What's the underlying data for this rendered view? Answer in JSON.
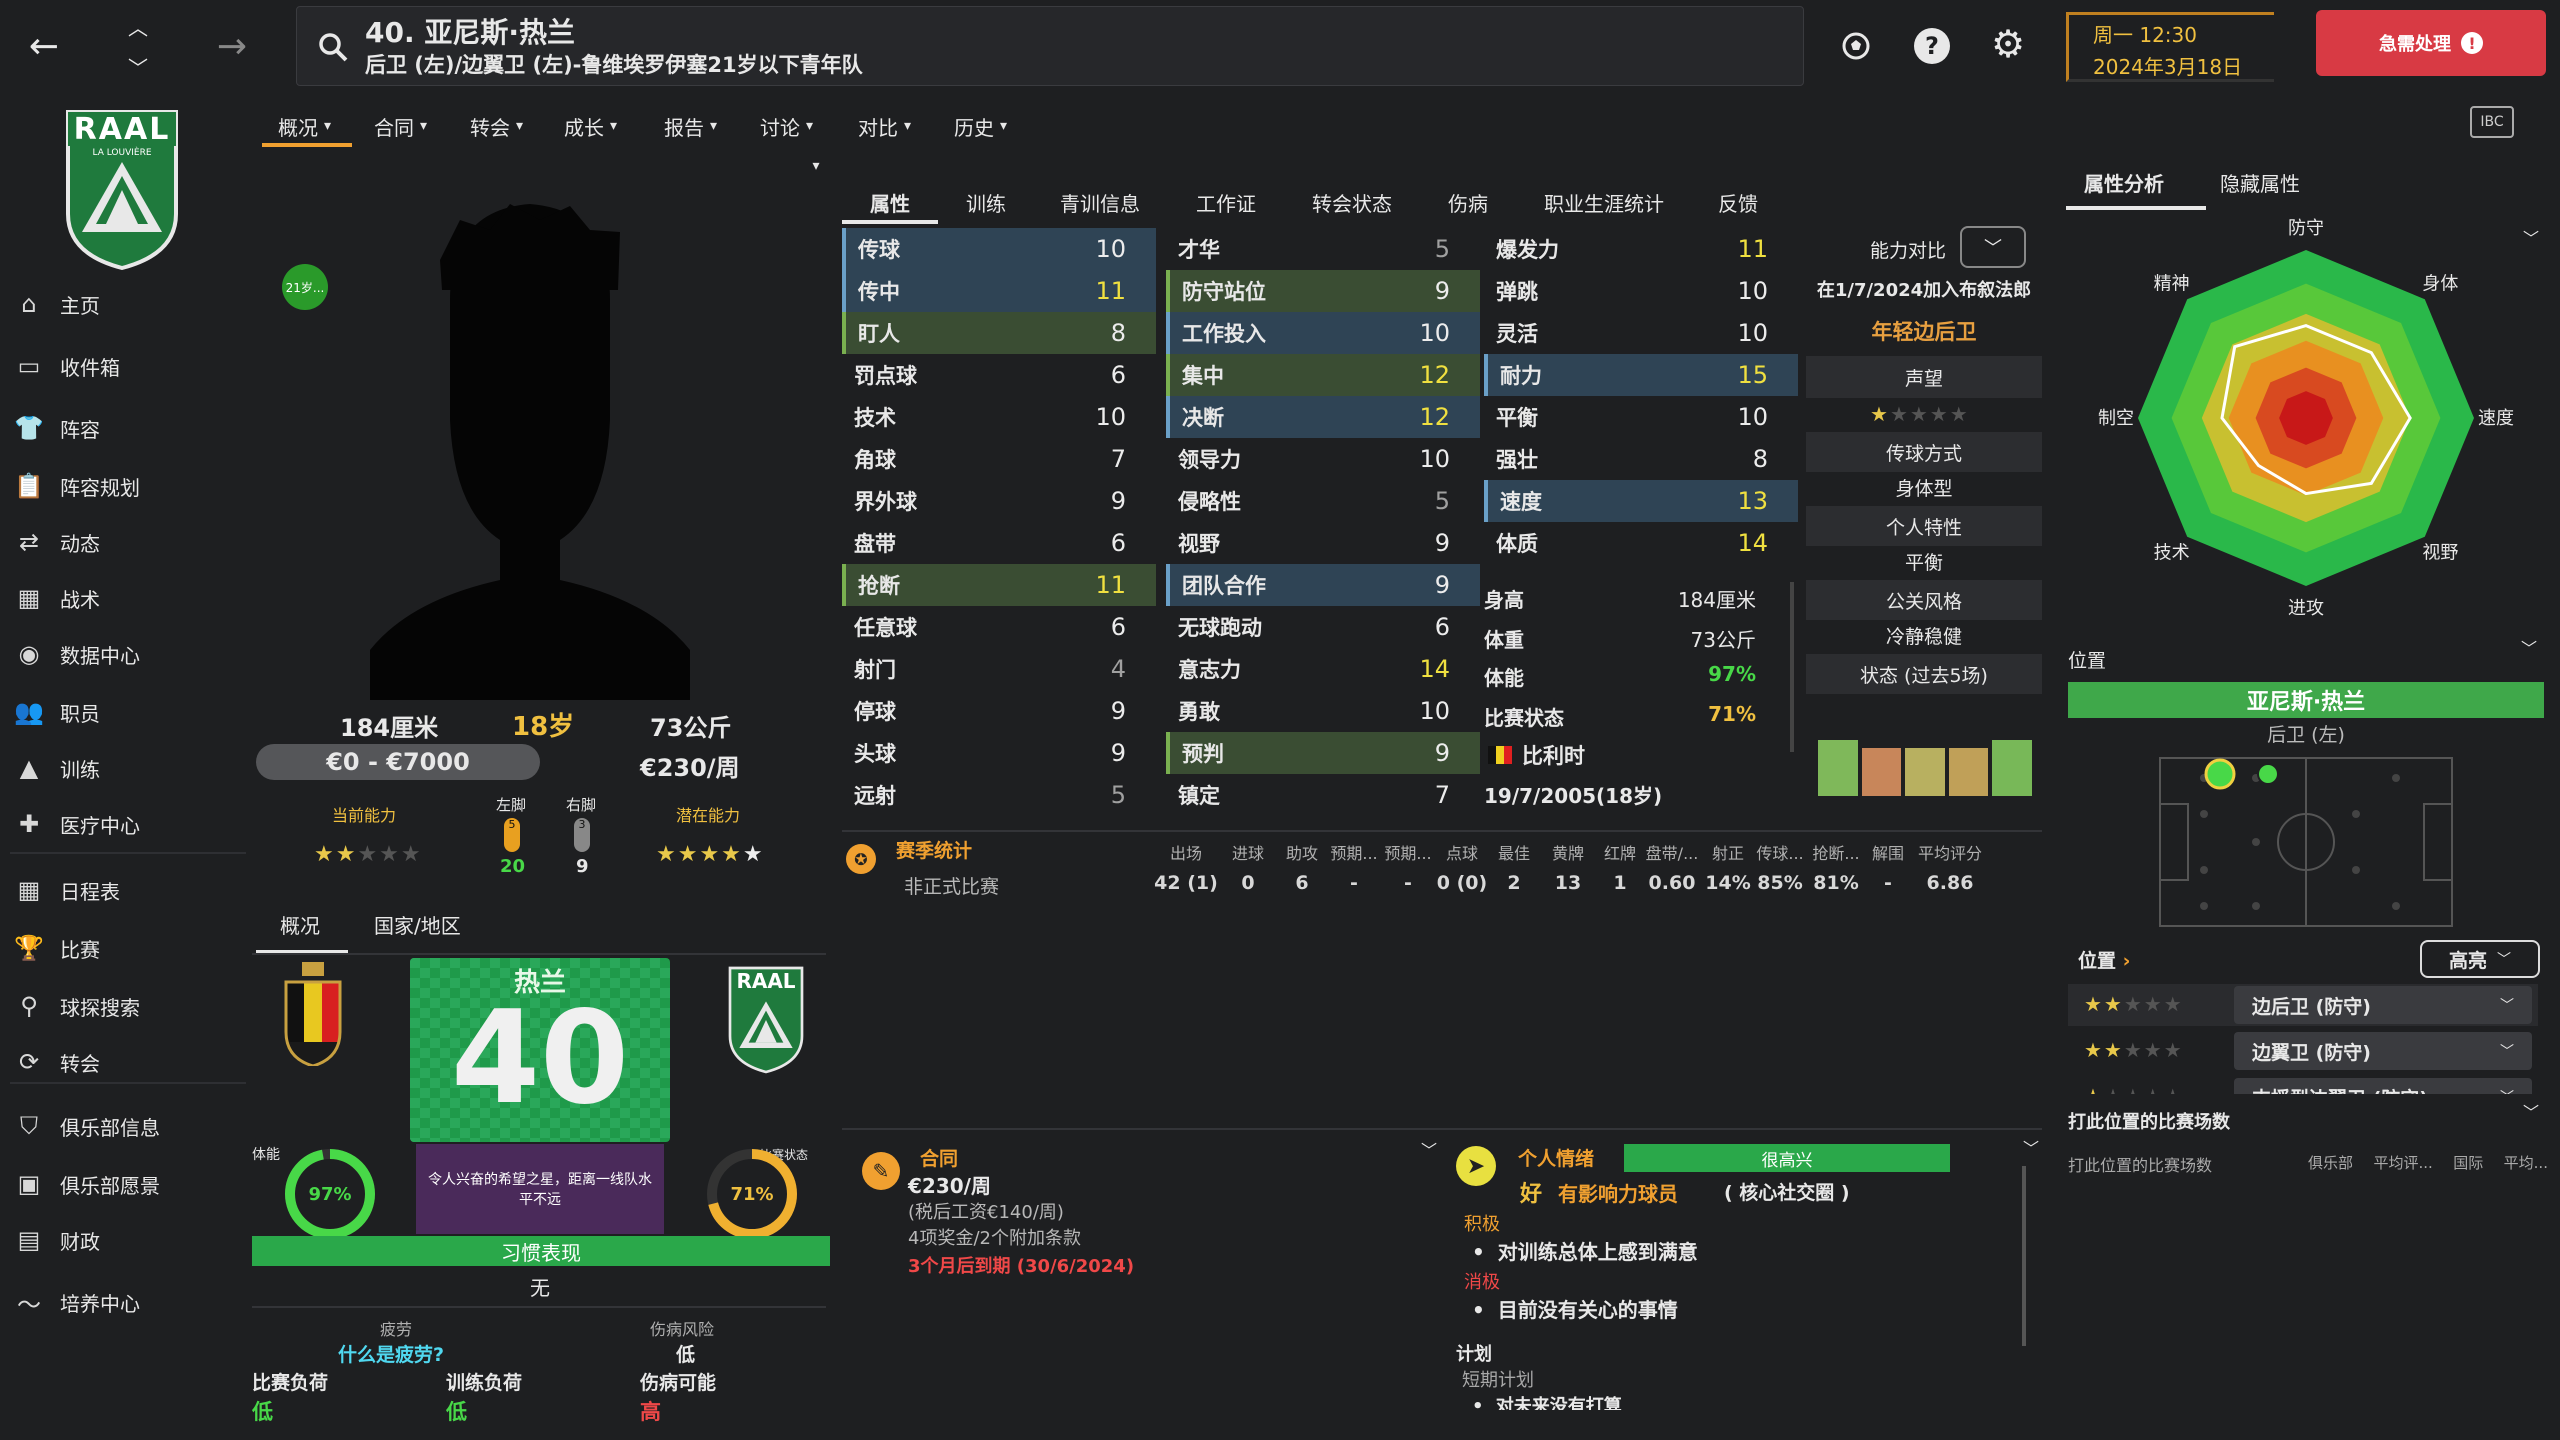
{
  "header": {
    "player_title": "40. 亚尼斯·热兰",
    "player_subtitle": "后卫 (左)/边翼卫 (左)-鲁维埃罗伊塞21岁以下青年队",
    "day_time": "周一 12:30",
    "date": "2024年3月18日",
    "urgent_label": "急需处理",
    "icons": [
      "back-arrow-icon",
      "up-chevron-icon",
      "down-chevron-icon",
      "forward-arrow-icon",
      "search-icon",
      "football-icon",
      "help-icon",
      "gear-icon",
      "alert-icon",
      "ibc-icon"
    ]
  },
  "club": {
    "badge_text": "RAAL",
    "badge_sub": "LA LOUVIÈRE"
  },
  "sidebar": {
    "items": [
      {
        "label": "主页",
        "icon": "home-icon"
      },
      {
        "label": "收件箱",
        "icon": "inbox-icon"
      },
      {
        "label": "阵容",
        "icon": "shirt-icon"
      },
      {
        "label": "阵容规划",
        "icon": "clipboard-icon"
      },
      {
        "label": "动态",
        "icon": "dynamics-icon"
      },
      {
        "label": "战术",
        "icon": "tactics-icon"
      },
      {
        "label": "数据中心",
        "icon": "data-icon"
      },
      {
        "label": "职员",
        "icon": "staff-icon"
      },
      {
        "label": "训练",
        "icon": "training-icon"
      },
      {
        "label": "医疗中心",
        "icon": "medical-icon"
      },
      {
        "label": "日程表",
        "icon": "calendar-icon"
      },
      {
        "label": "比赛",
        "icon": "trophy-icon"
      },
      {
        "label": "球探搜索",
        "icon": "scout-search-icon"
      },
      {
        "label": "转会",
        "icon": "transfer-icon"
      },
      {
        "label": "俱乐部信息",
        "icon": "shield-icon"
      },
      {
        "label": "俱乐部愿景",
        "icon": "vision-icon"
      },
      {
        "label": "财政",
        "icon": "finance-icon"
      },
      {
        "label": "培养中心",
        "icon": "development-icon"
      }
    ]
  },
  "menu": [
    "概况",
    "合同",
    "转会",
    "成长",
    "报告",
    "讨论",
    "对比",
    "历史"
  ],
  "subtabs": [
    "属性",
    "训练",
    "青训信息",
    "工作证",
    "转会状态",
    "伤病",
    "职业生涯统计",
    "反馈"
  ],
  "profile": {
    "age_badge": "21岁...",
    "height": "184厘米",
    "age": "18岁",
    "weight": "73公斤",
    "value": "€0 - €7000",
    "wage": "€230/周",
    "current_ability_label": "当前能力",
    "potential_ability_label": "潜在能力",
    "current_stars": 2,
    "potential_stars": 5,
    "left_foot_label": "左脚",
    "right_foot_label": "右脚",
    "left_foot_value": "20",
    "right_foot_value": "9",
    "left_foot_badge": "5",
    "right_foot_badge": "3"
  },
  "attributes": {
    "technical": [
      {
        "name": "传球",
        "value": "10",
        "hl": "b",
        "col": "w"
      },
      {
        "name": "传中",
        "value": "11",
        "hl": "b",
        "col": "y"
      },
      {
        "name": "盯人",
        "value": "8",
        "hl": "g",
        "col": "w"
      },
      {
        "name": "罚点球",
        "value": "6",
        "hl": "",
        "col": "w"
      },
      {
        "name": "技术",
        "value": "10",
        "hl": "",
        "col": "w"
      },
      {
        "name": "角球",
        "value": "7",
        "hl": "",
        "col": "w"
      },
      {
        "name": "界外球",
        "value": "9",
        "hl": "",
        "col": "w"
      },
      {
        "name": "盘带",
        "value": "6",
        "hl": "",
        "col": "w"
      },
      {
        "name": "抢断",
        "value": "11",
        "hl": "g",
        "col": "y"
      },
      {
        "name": "任意球",
        "value": "6",
        "hl": "",
        "col": "w"
      },
      {
        "name": "射门",
        "value": "4",
        "hl": "",
        "col": "g"
      },
      {
        "name": "停球",
        "value": "9",
        "hl": "",
        "col": "w"
      },
      {
        "name": "头球",
        "value": "9",
        "hl": "",
        "col": "w"
      },
      {
        "name": "远射",
        "value": "5",
        "hl": "",
        "col": "g"
      }
    ],
    "mental": [
      {
        "name": "才华",
        "value": "5",
        "hl": "",
        "col": "g"
      },
      {
        "name": "防守站位",
        "value": "9",
        "hl": "g",
        "col": "w"
      },
      {
        "name": "工作投入",
        "value": "10",
        "hl": "b",
        "col": "w"
      },
      {
        "name": "集中",
        "value": "12",
        "hl": "g",
        "col": "y"
      },
      {
        "name": "决断",
        "value": "12",
        "hl": "b",
        "col": "y"
      },
      {
        "name": "领导力",
        "value": "10",
        "hl": "",
        "col": "w"
      },
      {
        "name": "侵略性",
        "value": "5",
        "hl": "",
        "col": "g"
      },
      {
        "name": "视野",
        "value": "9",
        "hl": "",
        "col": "w"
      },
      {
        "name": "团队合作",
        "value": "9",
        "hl": "b",
        "col": "w"
      },
      {
        "name": "无球跑动",
        "value": "6",
        "hl": "",
        "col": "w"
      },
      {
        "name": "意志力",
        "value": "14",
        "hl": "",
        "col": "y"
      },
      {
        "name": "勇敢",
        "value": "10",
        "hl": "",
        "col": "w"
      },
      {
        "name": "预判",
        "value": "9",
        "hl": "g",
        "col": "w"
      },
      {
        "name": "镇定",
        "value": "7",
        "hl": "",
        "col": "w"
      }
    ],
    "physical": [
      {
        "name": "爆发力",
        "value": "11",
        "hl": "",
        "col": "y"
      },
      {
        "name": "弹跳",
        "value": "10",
        "hl": "",
        "col": "w"
      },
      {
        "name": "灵活",
        "value": "10",
        "hl": "",
        "col": "w"
      },
      {
        "name": "耐力",
        "value": "15",
        "hl": "b",
        "col": "y"
      },
      {
        "name": "平衡",
        "value": "10",
        "hl": "",
        "col": "w"
      },
      {
        "name": "强壮",
        "value": "8",
        "hl": "",
        "col": "w"
      },
      {
        "name": "速度",
        "value": "13",
        "hl": "b",
        "col": "y"
      },
      {
        "name": "体质",
        "value": "14",
        "hl": "",
        "col": "y"
      }
    ]
  },
  "physinfo": {
    "height_label": "身高",
    "height": "184厘米",
    "weight_label": "体重",
    "weight": "73公斤",
    "fitness_label": "体能",
    "fitness": "97%",
    "match_label": "比赛状态",
    "match": "71%",
    "nation": "比利时",
    "dob": "19/7/2005(18岁)"
  },
  "compare": {
    "label": "能力对比",
    "joined": "在1/7/2024加入布叙法郎",
    "role": "年轻边后卫",
    "reputation_label": "声望",
    "reputation_stars": 1,
    "pass_style_label": "传球方式",
    "pass_style": "身体型",
    "personality_label": "个人特性",
    "personality": "平衡",
    "media_label": "公关风格",
    "media": "冷静稳健",
    "form_label": "状态 (过去5场)",
    "form_colors": [
      "#7fb85a",
      "#c8865a",
      "#b8b060",
      "#c0a058",
      "#78b858"
    ]
  },
  "season": {
    "label": "赛季统计",
    "headers": [
      "出场",
      "进球",
      "助攻",
      "预期...",
      "预期...",
      "点球",
      "最佳",
      "黄牌",
      "红牌",
      "盘带/...",
      "射正",
      "传球...",
      "抢断...",
      "解围",
      "平均评分"
    ],
    "row_label": "非正式比赛",
    "values": [
      "42 (1)",
      "0",
      "6",
      "-",
      "-",
      "0 (0)",
      "2",
      "13",
      "1",
      "0.60",
      "14%",
      "85%",
      "81%",
      "-",
      "6.86"
    ]
  },
  "bottomtabs": [
    "概况",
    "国家/地区"
  ],
  "shirt": {
    "name": "热兰",
    "number": "40"
  },
  "fitness_ring": {
    "label": "体能",
    "value": "97%",
    "fraction": 0.97
  },
  "match_ring": {
    "label": "比赛状态",
    "value": "71%",
    "fraction": 0.71
  },
  "morale_text": "令人兴奋的希望之星，距离一线队水平不远",
  "habit": {
    "label": "习惯表现",
    "value": "无"
  },
  "fatigue": {
    "label": "疲劳",
    "question": "什么是疲劳?",
    "injury_risk_label": "伤病风险",
    "injury_risk": "低",
    "match_load_label": "比赛负荷",
    "match_load": "低",
    "training_load_label": "训练负荷",
    "training_load": "低",
    "injury_possibility_label": "伤病可能",
    "injury_possibility": "高"
  },
  "contract": {
    "label": "合同",
    "wage": "€230/周",
    "pre_tax": "(税后工资€140/周)",
    "bonuses": "4项奖金/2个附加条款",
    "expiry": "3个月后到期 (30/6/2024)"
  },
  "mood": {
    "label": "个人情绪",
    "bar_text": "很高兴",
    "level": "好",
    "status": "有影响力球员",
    "status_detail": "( 核心社交圈 )",
    "positive_label": "积极",
    "positive": "对训练总体上感到满意",
    "negative_label": "消极",
    "negative": "目前没有关心的事情",
    "plans_label": "计划",
    "short_plan_label": "短期计划",
    "short_plan": "对未来没有打算"
  },
  "right": {
    "tabs": [
      "属性分析",
      "隐藏属性"
    ],
    "radar_labels": [
      "防守",
      "身体",
      "速度",
      "视野",
      "进攻",
      "技术",
      "制空",
      "精神"
    ],
    "radar_values": [
      0.55,
      0.55,
      0.62,
      0.55,
      0.45,
      0.4,
      0.5,
      0.6
    ],
    "position_label": "位置",
    "player_name": "亚尼斯·热兰",
    "player_pos": "后卫 (左)",
    "positions_label": "位置",
    "highlight_label": "高亮",
    "roles": [
      {
        "stars": 2,
        "role": "边后卫 (防守)"
      },
      {
        "stars": 2,
        "role": "边翼卫 (防守)"
      },
      {
        "stars": 1,
        "role": "支援型边翼卫 (防守)"
      }
    ],
    "match_count_label": "打此位置的比赛场数",
    "match_count_sub": "打此位置的比赛场数",
    "match_count_cols": [
      "俱乐部",
      "平均评...",
      "国际",
      "平均..."
    ]
  },
  "colors": {
    "accent": "#48d848",
    "urgent": "#d83a44",
    "gold": "#f0c040",
    "bg": "#1e1f21"
  }
}
